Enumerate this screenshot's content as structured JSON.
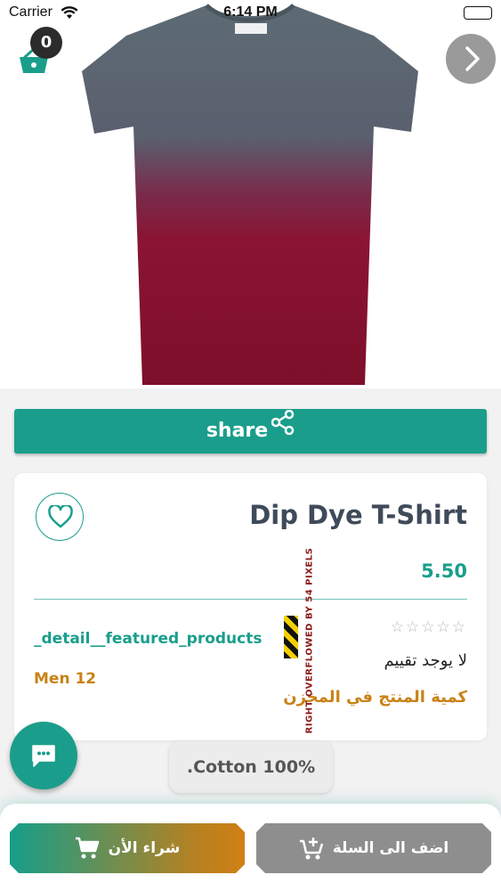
{
  "status_bar": {
    "carrier": "Carrier",
    "time": "6:14 PM"
  },
  "cart": {
    "count": "0"
  },
  "share": {
    "label": "share"
  },
  "product": {
    "title": "Dip Dye T-Shirt",
    "price": "5.50",
    "featured_label": "_detail__featured_products",
    "category": "Men 12",
    "rating_stars": "☆☆☆☆☆",
    "no_rating": "لا يوجد تقييم",
    "stock_label": "كمية المنتج في المخزن",
    "material": ".Cotton 100%"
  },
  "overflow_warning": "RIGHT OVERFLOWED BY 54 PIXELS",
  "bottom_bar": {
    "buy_now": "شراء الأن",
    "add_to_cart": "اضف الى السلة"
  },
  "colors": {
    "accent": "#1a9e8b",
    "orange": "#c98216",
    "title": "#3f4a5a",
    "grey_button": "#8e8e8e"
  },
  "icons": {
    "cart": "basket-icon",
    "next": "chevron-right-icon",
    "share": "share-icon",
    "favorite": "heart-icon",
    "chat": "chat-bubble-icon",
    "add_cart": "add-cart-icon",
    "buy_cart": "cart-icon"
  }
}
